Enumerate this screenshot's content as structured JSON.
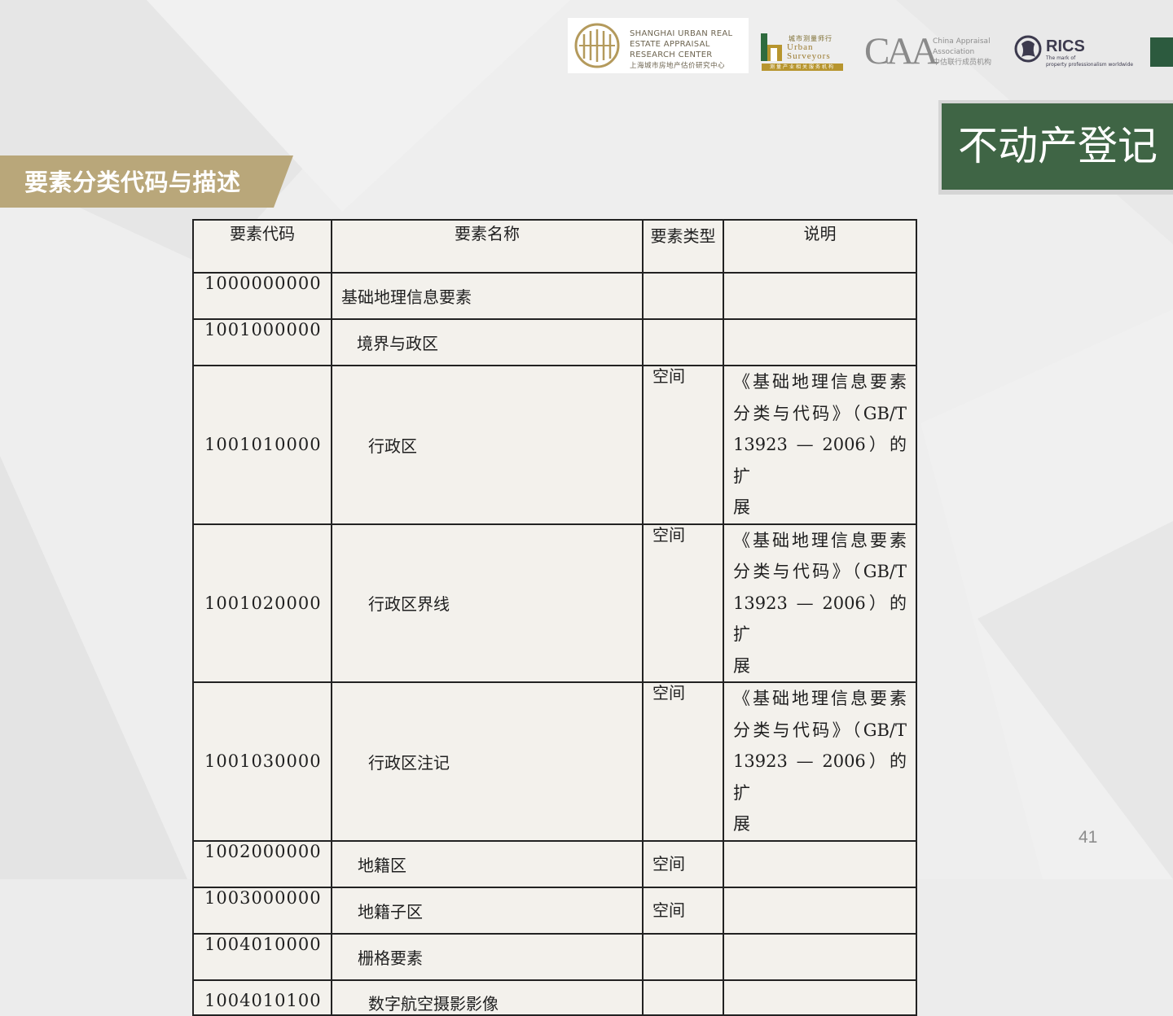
{
  "logos": {
    "surc_en": [
      "SHANGHAI URBAN REAL",
      "ESTATE APPRAISAL",
      "RESEARCH CENTER"
    ],
    "surc_cn": "上海城市房地产估价研究中心",
    "urban_cn": "城市测量师行",
    "urban_en": [
      "Urban",
      "Surveyors"
    ],
    "urban_sub": "测量产业相关服务机构",
    "caa_mark": "CAA",
    "caa_text": [
      "China Appraisal",
      "Association",
      "中估联行成员机构"
    ],
    "rics_name": "RICS",
    "rics_sub": [
      "The mark of",
      "property professionalism worldwide"
    ]
  },
  "title": "不动产登记",
  "section_title": "要素分类代码与描述",
  "table": {
    "headers": [
      "要素代码",
      "要素名称",
      "要素类型",
      "说明"
    ],
    "rows": [
      {
        "code": "1000000000",
        "name": "基础地理信息要素",
        "type": "",
        "desc": ""
      },
      {
        "code": "1001000000",
        "name": "境界与政区",
        "type": "",
        "desc": ""
      },
      {
        "code": "1001010000",
        "name": "行政区",
        "type": "空间",
        "desc": "《基础地理信息要素分类与代码》（GB/T 13923 — 2006）的扩展"
      },
      {
        "code": "1001020000",
        "name": "行政区界线",
        "type": "空间",
        "desc": "《基础地理信息要素分类与代码》（GB/T 13923 — 2006）的扩展"
      },
      {
        "code": "1001030000",
        "name": "行政区注记",
        "type": "空间",
        "desc": "《基础地理信息要素分类与代码》（GB/T 13923 — 2006）的扩展"
      },
      {
        "code": "1002000000",
        "name": "地籍区",
        "type": "空间",
        "desc": ""
      },
      {
        "code": "1003000000",
        "name": "地籍子区",
        "type": "空间",
        "desc": ""
      },
      {
        "code": "1004010000",
        "name": "栅格要素",
        "type": "",
        "desc": ""
      },
      {
        "code": "1004010100",
        "name": "数字航空摄影影像",
        "type": "",
        "desc": ""
      }
    ],
    "desc_lines": [
      "《基础地理信息要素",
      "分类与代码》（GB/T",
      "13923 — 2006）的扩",
      "展"
    ]
  },
  "page_number": "41",
  "colors": {
    "accent_gold": "#b9a77a",
    "title_green": "#3f6545",
    "background": "#ececec"
  }
}
